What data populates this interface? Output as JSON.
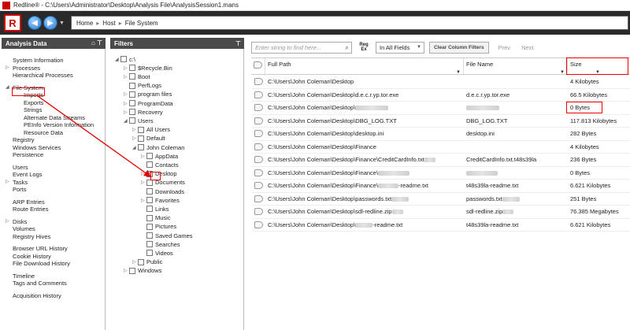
{
  "window": {
    "title": "Redline® - C:\\Users\\Administrator\\Desktop\\Analysis File\\AnalysisSession1.mans"
  },
  "nav": {
    "logo": "R",
    "back": "◀",
    "forward": "▶",
    "dropdown": "▼",
    "crumbs": [
      "Home",
      "Host",
      "File System"
    ],
    "sep": "▸"
  },
  "analysis": {
    "title": "Analysis Data",
    "icons": "⌂ ⊤",
    "items": [
      {
        "label": "System Information",
        "sub": false
      },
      {
        "label": "Processes",
        "sub": false,
        "expander": "▷"
      },
      {
        "label": "Hierarchical Processes",
        "sub": false
      },
      {
        "gap": true
      },
      {
        "label": "File System",
        "sub": false,
        "expander": "◢",
        "highlight": true
      },
      {
        "label": "Imports",
        "sub": true
      },
      {
        "label": "Exports",
        "sub": true
      },
      {
        "label": "Strings",
        "sub": true
      },
      {
        "label": "Alternate Data Streams",
        "sub": true
      },
      {
        "label": "PEInfo Version Information",
        "sub": true
      },
      {
        "label": "Resource Data",
        "sub": true
      },
      {
        "label": "Registry",
        "sub": false
      },
      {
        "label": "Windows Services",
        "sub": false
      },
      {
        "label": "Persistence",
        "sub": false
      },
      {
        "gap": true
      },
      {
        "label": "Users",
        "sub": false
      },
      {
        "label": "Event Logs",
        "sub": false
      },
      {
        "label": "Tasks",
        "sub": false,
        "expander": "▷"
      },
      {
        "label": "Ports",
        "sub": false
      },
      {
        "gap": true
      },
      {
        "label": "ARP Entries",
        "sub": false
      },
      {
        "label": "Route Entries",
        "sub": false
      },
      {
        "gap": true
      },
      {
        "label": "Disks",
        "sub": false,
        "expander": "▷"
      },
      {
        "label": "Volumes",
        "sub": false
      },
      {
        "label": "Registry Hives",
        "sub": false
      },
      {
        "gap": true
      },
      {
        "label": "Browser URL History",
        "sub": false
      },
      {
        "label": "Cookie History",
        "sub": false
      },
      {
        "label": "File Download History",
        "sub": false
      },
      {
        "gap": true
      },
      {
        "label": "Timeline",
        "sub": false
      },
      {
        "label": "Tags and Comments",
        "sub": false
      },
      {
        "gap": true
      },
      {
        "label": "Acquisition History",
        "sub": false
      }
    ]
  },
  "filters": {
    "title": "Filters",
    "pin": "⊤",
    "tree": [
      {
        "label": "c:\\",
        "level": 0,
        "toggle": "◢",
        "checked": false
      },
      {
        "label": "$Recycle.Bin",
        "level": 1,
        "toggle": "▷",
        "checked": false
      },
      {
        "label": "Boot",
        "level": 1,
        "toggle": "▷",
        "checked": false
      },
      {
        "label": "PerfLogs",
        "level": 1,
        "toggle": "",
        "checked": false
      },
      {
        "label": "program files",
        "level": 1,
        "toggle": "▷",
        "checked": false
      },
      {
        "label": "ProgramData",
        "level": 1,
        "toggle": "▷",
        "checked": false
      },
      {
        "label": "Recovery",
        "level": 1,
        "toggle": "▷",
        "checked": false
      },
      {
        "label": "Users",
        "level": 1,
        "toggle": "◢",
        "checked": false
      },
      {
        "label": "All Users",
        "level": 2,
        "toggle": "▷",
        "checked": false
      },
      {
        "label": "Default",
        "level": 2,
        "toggle": "▷",
        "checked": false
      },
      {
        "label": "John Coleman",
        "level": 2,
        "toggle": "◢",
        "checked": false
      },
      {
        "label": "AppData",
        "level": 3,
        "toggle": "▷",
        "checked": false
      },
      {
        "label": "Contacts",
        "level": 3,
        "toggle": "",
        "checked": false
      },
      {
        "label": "Desktop",
        "level": 3,
        "toggle": "▷",
        "checked": true
      },
      {
        "label": "Documents",
        "level": 3,
        "toggle": "▷",
        "checked": false
      },
      {
        "label": "Downloads",
        "level": 3,
        "toggle": "",
        "checked": false
      },
      {
        "label": "Favorites",
        "level": 3,
        "toggle": "▷",
        "checked": false
      },
      {
        "label": "Links",
        "level": 3,
        "toggle": "",
        "checked": false
      },
      {
        "label": "Music",
        "level": 3,
        "toggle": "",
        "checked": false
      },
      {
        "label": "Pictures",
        "level": 3,
        "toggle": "",
        "checked": false
      },
      {
        "label": "Saved Games",
        "level": 3,
        "toggle": "",
        "checked": false
      },
      {
        "label": "Searches",
        "level": 3,
        "toggle": "",
        "checked": false
      },
      {
        "label": "Videos",
        "level": 3,
        "toggle": "",
        "checked": false
      },
      {
        "label": "Public",
        "level": 2,
        "toggle": "▷",
        "checked": false
      },
      {
        "label": "Windows",
        "level": 1,
        "toggle": "▷",
        "checked": false
      }
    ]
  },
  "toolbar": {
    "search_placeholder": "Enter string to find here...",
    "regex_label": "Reg Ex",
    "field_select": "In All Fields",
    "clear_label": "Clear Column Filters",
    "prev": "Prev",
    "next": "Next"
  },
  "table": {
    "columns": [
      {
        "label": "Full Path"
      },
      {
        "label": "File Name"
      },
      {
        "label": "Size"
      }
    ],
    "filter_glyph": "▼",
    "rows": [
      {
        "path": "C:\\Users\\John Coleman\\Desktop",
        "path_blur": 0,
        "name": "",
        "name_blur": 0,
        "size": "4 Kilobytes"
      },
      {
        "path": "C:\\Users\\John Coleman\\Desktop\\d.e.c.r.yp.tor.exe",
        "path_blur": 0,
        "name": "d.e.c.r.yp.tor.exe",
        "name_blur": 0,
        "size": "66.5 Kilobytes"
      },
      {
        "path": "C:\\Users\\John Coleman\\Desktop\\",
        "path_blur": 42,
        "name": "",
        "name_blur": 42,
        "size": "0 Bytes",
        "size_highlight": true
      },
      {
        "path": "C:\\Users\\John Coleman\\Desktop\\DBG_LOG.TXT",
        "path_blur": 0,
        "name": "DBG_LOG.TXT",
        "name_blur": 0,
        "size": "117.813 Kilobytes"
      },
      {
        "path": "C:\\Users\\John Coleman\\Desktop\\desktop.ini",
        "path_blur": 0,
        "name": "desktop.ini",
        "name_blur": 0,
        "size": "282 Bytes"
      },
      {
        "path": "C:\\Users\\John Coleman\\Desktop\\Finance",
        "path_blur": 0,
        "name": "",
        "name_blur": 0,
        "size": "4 Kilobytes"
      },
      {
        "path": "C:\\Users\\John Coleman\\Desktop\\Finance\\CreditCardInfo.txt",
        "path_blur": 14,
        "name": "CreditCardInfo.txt.t48s39la",
        "name_blur": 0,
        "size": "236 Bytes"
      },
      {
        "path": "C:\\Users\\John Coleman\\Desktop\\Finance\\",
        "path_blur": 40,
        "name": "",
        "name_blur": 40,
        "size": "0 Bytes"
      },
      {
        "path": "C:\\Users\\John Coleman\\Desktop\\Finance\\",
        "path_blur": 26,
        "path_suffix": "-readme.txt",
        "name": "t48s39la-readme.txt",
        "name_blur": 0,
        "size": "6.621 Kilobytes"
      },
      {
        "path": "C:\\Users\\John Coleman\\Desktop\\passwords.txt",
        "path_blur": 22,
        "name": "passwords.txt",
        "name_blur": 22,
        "size": "251 Bytes"
      },
      {
        "path": "C:\\Users\\John Coleman\\Desktop\\sdl-redline.zip",
        "path_blur": 14,
        "name": "sdl-redline.zip",
        "name_blur": 14,
        "size": "76.385 Megabytes"
      },
      {
        "path": "C:\\Users\\John Coleman\\Desktop\\",
        "path_blur": 22,
        "path_suffix": "-readme.txt",
        "name": "t48s39la-readme.txt",
        "name_blur": 0,
        "size": "6.621 Kilobytes"
      }
    ]
  },
  "colors": {
    "highlight": "#e00000",
    "header_bg": "#4a4a4a",
    "nav_bg": "#2a2a2a"
  }
}
